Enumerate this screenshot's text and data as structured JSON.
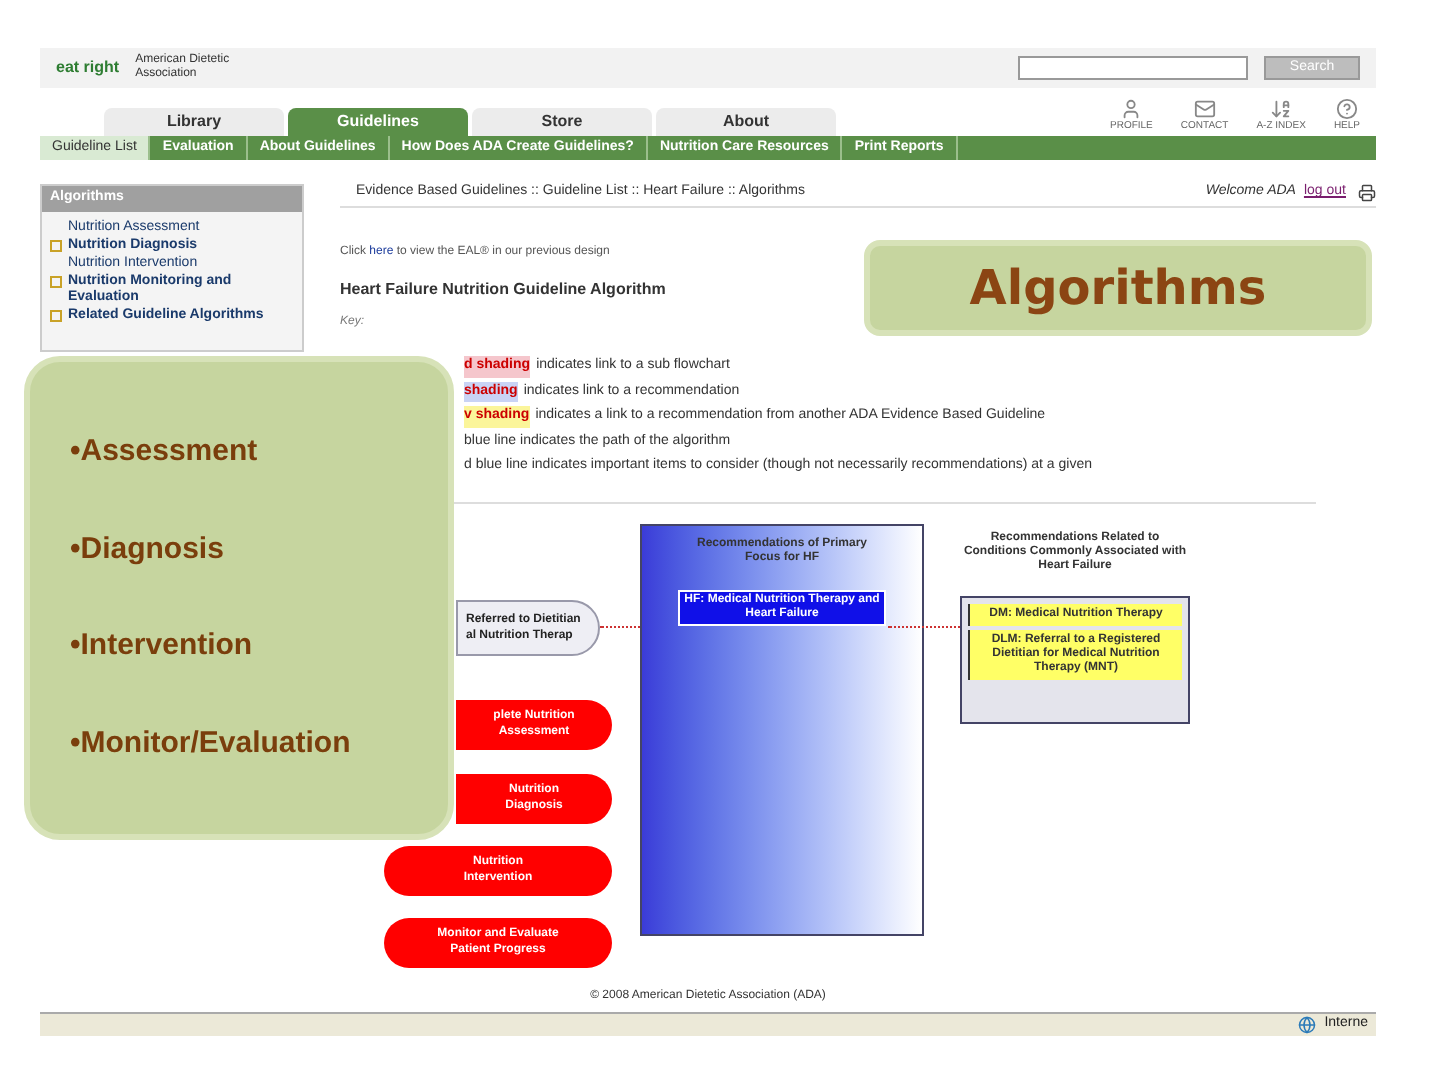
{
  "header": {
    "logo": "eat right",
    "org": "American Dietetic Association",
    "search_button": "Search",
    "quick_links": [
      {
        "label": "PROFILE",
        "kind": "person"
      },
      {
        "label": "CONTACT",
        "kind": "mail"
      },
      {
        "label": "A-Z INDEX",
        "kind": "sort"
      },
      {
        "label": "HELP",
        "kind": "help"
      }
    ]
  },
  "tabs": [
    {
      "label": "Library",
      "selected": false
    },
    {
      "label": "Guidelines",
      "selected": true
    },
    {
      "label": "Store",
      "selected": false
    },
    {
      "label": "About",
      "selected": false
    }
  ],
  "subnav": [
    {
      "label": "Guideline List",
      "selected": true
    },
    {
      "label": "Evaluation",
      "selected": false
    },
    {
      "label": "About Guidelines",
      "selected": false
    },
    {
      "label": "How Does ADA Create Guidelines?",
      "selected": false
    },
    {
      "label": "Nutrition Care Resources",
      "selected": false
    },
    {
      "label": "Print Reports",
      "selected": false
    }
  ],
  "sidebar": {
    "title": "Algorithms",
    "items": [
      {
        "label": "Nutrition Assessment",
        "expandable": false
      },
      {
        "label": "Nutrition Diagnosis",
        "expandable": true
      },
      {
        "label": "Nutrition Intervention",
        "expandable": false
      },
      {
        "label": "Nutrition Monitoring and Evaluation",
        "expandable": true
      },
      {
        "label": "Related Guideline Algorithms",
        "expandable": true
      }
    ]
  },
  "breadcrumb": "Evidence Based Guidelines :: Guideline List :: Heart Failure :: Algorithms",
  "welcome": "Welcome ADA",
  "logout": "log out",
  "notice": {
    "pre": "Click ",
    "link": "here",
    "post": " to view the EAL® in our previous design"
  },
  "page_title": "Heart Failure Nutrition Guideline Algorithm",
  "key_label": "Key:",
  "key": [
    {
      "lead": "d shading",
      "text": "indicates link to a sub flowchart",
      "color": "#f5c6cc"
    },
    {
      "lead": "shading",
      "text": "indicates link to a recommendation",
      "color": "#c9d3f5"
    },
    {
      "lead": "v shading",
      "text": "indicates a link to a recommendation from another ADA Evidence Based Guideline",
      "color": "#fbf59a"
    },
    {
      "text": "blue line indicates the path of the algorithm"
    },
    {
      "text": "d blue line indicates important items to consider (though not necessarily recommendations) at a given"
    }
  ],
  "flowchart": {
    "start": [
      "Referred to Dietitian",
      "al Nutrition Therap"
    ],
    "steps": [
      [
        "plete Nutrition",
        "Assessment"
      ],
      [
        "Nutrition",
        "Diagnosis"
      ],
      [
        "Nutrition",
        "Intervention"
      ],
      [
        "Monitor and Evaluate",
        "Patient Progress"
      ]
    ],
    "primary_title": "Recommendations of Primary Focus for HF",
    "primary_item": "HF: Medical Nutrition Therapy and Heart Failure",
    "related_title": "Recommendations Related to Conditions Commonly Associated with Heart Failure",
    "related_items": [
      "DM: Medical Nutrition Therapy",
      "DLM: Referral to a Registered Dietitian for Medical Nutrition Therapy (MNT)"
    ]
  },
  "copyright": "© 2008 American Dietetic Association (ADA)",
  "status_bar": {
    "zone": "Interne"
  },
  "slide": {
    "title": "Algorithms",
    "bullets": [
      "•Assessment",
      "•Diagnosis",
      "•Intervention",
      "•Monitor/Evaluation"
    ]
  }
}
